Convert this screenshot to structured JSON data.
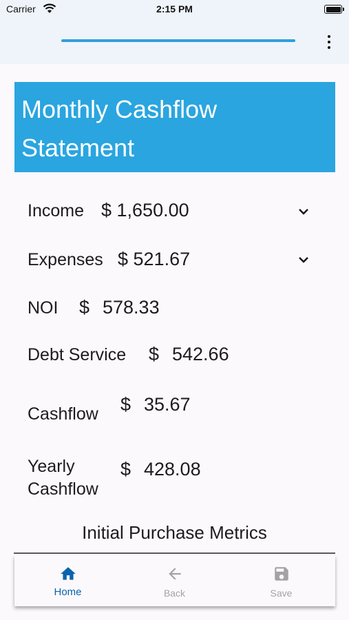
{
  "status_bar": {
    "carrier": "Carrier",
    "time": "2:15 PM"
  },
  "app_bar": {
    "progress": 1.0,
    "menu_icon": "more-vert-icon"
  },
  "title": "Monthly Cashflow Statement",
  "rows": {
    "income": {
      "label": "Income",
      "value": "$ 1,650.00"
    },
    "expenses": {
      "label": "Expenses",
      "value": "$ 521.67"
    },
    "noi": {
      "label": "NOI",
      "currency": "$",
      "value": "578.33"
    },
    "debt_service": {
      "label": "Debt Service",
      "currency": "$",
      "value": "542.66"
    },
    "cashflow": {
      "label": "Cashflow",
      "currency": "$",
      "value": "35.67"
    },
    "yearly_cashflow": {
      "label_line1": "Yearly",
      "label_line2": "Cashflow",
      "currency": "$",
      "value": "428.08"
    }
  },
  "section_title": "Initial Purchase Metrics",
  "bottom_nav": {
    "home": {
      "label": "Home",
      "icon": "home-icon"
    },
    "back": {
      "label": "Back",
      "icon": "arrow-back-icon"
    },
    "save": {
      "label": "Save",
      "icon": "save-icon"
    }
  },
  "colors": {
    "accent": "#2aa5e0",
    "nav_active": "#0a63ad",
    "nav_inactive": "#a3a3a3",
    "app_bar_bg": "#eef4f9"
  }
}
